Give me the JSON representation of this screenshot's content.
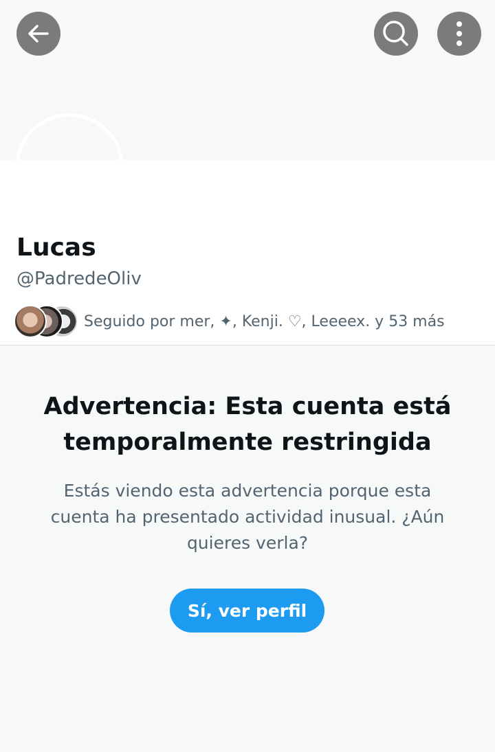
{
  "header": {
    "back_icon": "arrow-left-icon",
    "search_icon": "search-icon",
    "more_icon": "more-vertical-icon"
  },
  "profile": {
    "display_name": "Lucas",
    "handle": "@PadredeOliv",
    "followed_by": "Seguido por mer, ✦, Kenji. ♡, Leeeex. y 53 más"
  },
  "warning": {
    "title": "Advertencia: Esta cuenta está temporalmente restringida",
    "body": "Estás viendo esta advertencia porque esta cuenta ha presentado actividad inusual. ¿Aún quieres verla?",
    "button_label": "Sí, ver perfil"
  },
  "colors": {
    "accent": "#1d9bf0",
    "icon_button_bg": "#7c7a7a",
    "background": "#f7f9f9",
    "primary_text": "#0f1419",
    "secondary_text": "#536471"
  }
}
